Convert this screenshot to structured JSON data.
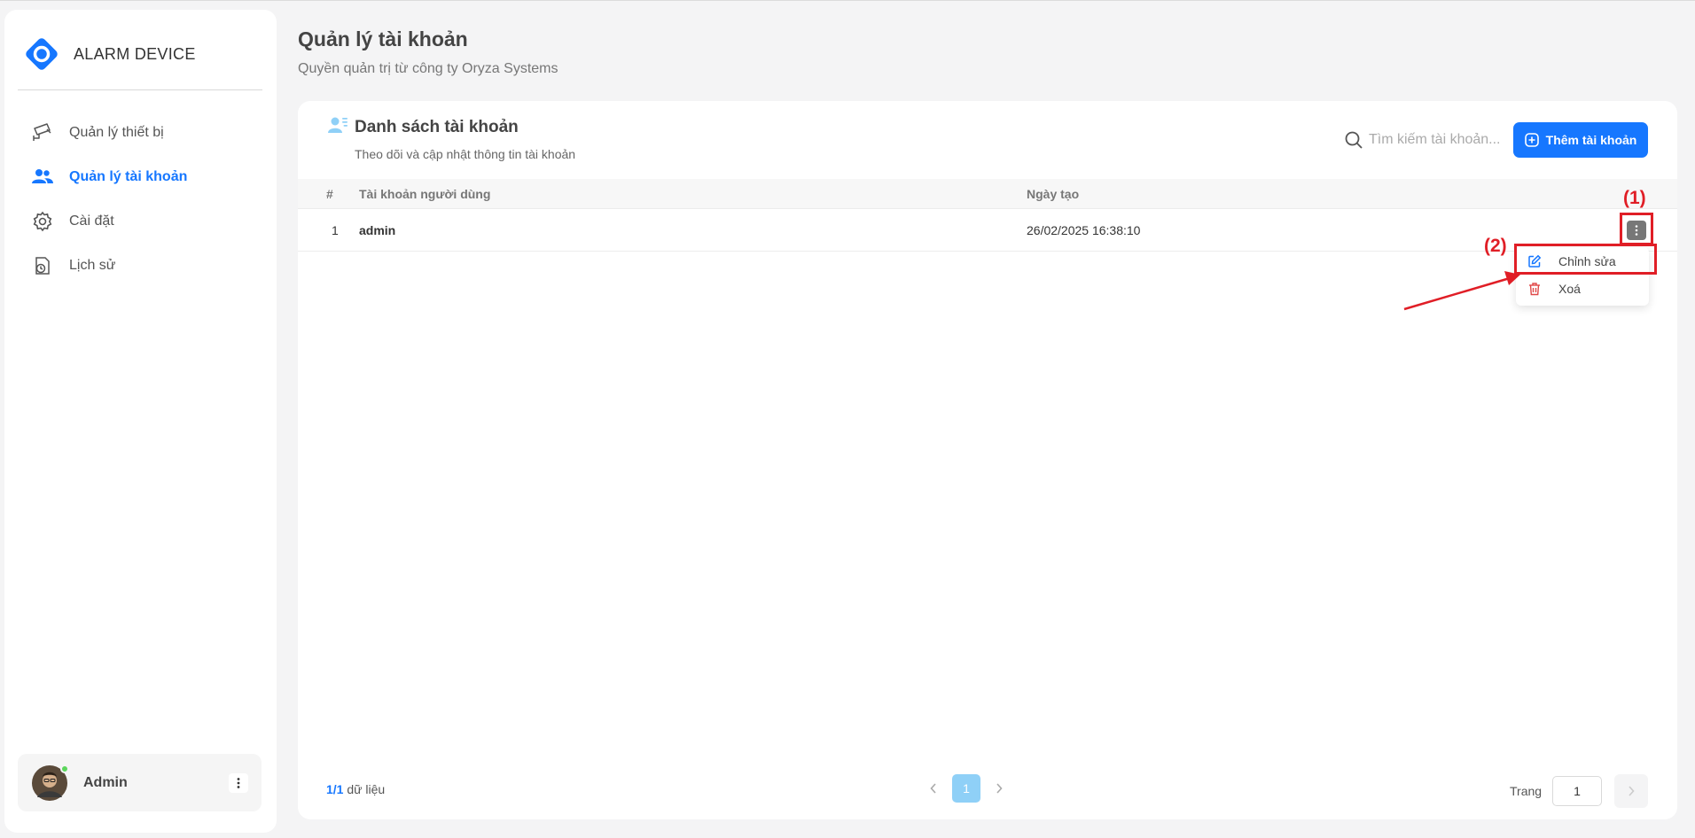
{
  "app": {
    "name": "ALARM DEVICE"
  },
  "sidebar": {
    "items": [
      {
        "label": "Quản lý thiết bị",
        "icon": "cctv-camera-icon",
        "active": false
      },
      {
        "label": "Quản lý tài khoản",
        "icon": "users-icon",
        "active": true
      },
      {
        "label": "Cài đặt",
        "icon": "gear-icon",
        "active": false
      },
      {
        "label": "Lịch sử",
        "icon": "history-icon",
        "active": false
      }
    ],
    "user": {
      "name": "Admin"
    }
  },
  "header": {
    "title": "Quản lý tài khoản",
    "subtitle": "Quyền quản trị từ công ty Oryza Systems"
  },
  "card": {
    "title": "Danh sách tài khoản",
    "subtitle": "Theo dõi và cập nhật thông tin tài khoản",
    "search_placeholder": "Tìm kiếm tài khoản...",
    "add_button": "Thêm tài khoản"
  },
  "table": {
    "columns": [
      "#",
      "Tài khoản người dùng",
      "Ngày tạo"
    ],
    "rows": [
      {
        "index": "1",
        "username": "admin",
        "created": "26/02/2025 16:38:10"
      }
    ]
  },
  "row_menu": {
    "edit": "Chỉnh sửa",
    "delete": "Xoá"
  },
  "annotations": {
    "marker1": "(1)",
    "marker2": "(2)",
    "color": "#e01e26"
  },
  "footer": {
    "count_current": "1/1",
    "count_suffix": "dữ liệu",
    "current_page": "1",
    "page_label": "Trang",
    "page_input_value": "1"
  },
  "colors": {
    "primary": "#1677ff",
    "active_page": "#8fd0f7",
    "online": "#5cd65c"
  }
}
